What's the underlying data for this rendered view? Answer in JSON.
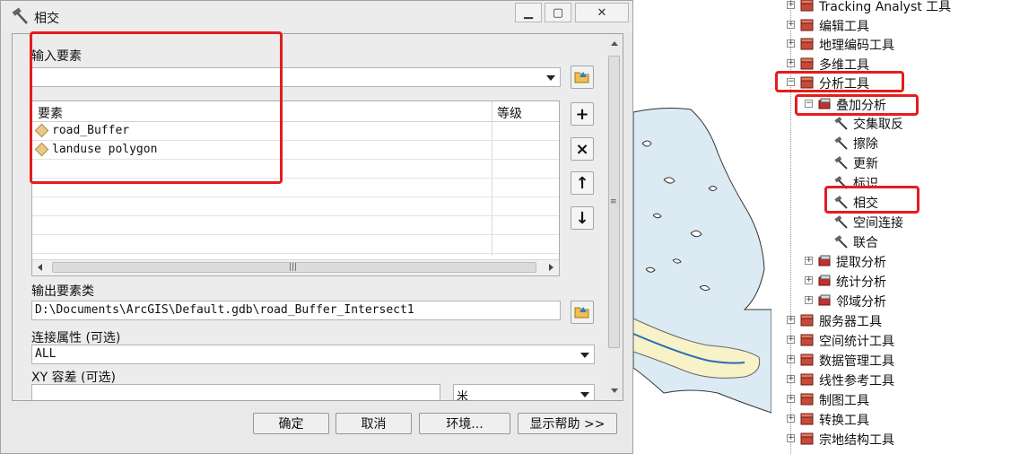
{
  "dialog": {
    "title": "相交",
    "window_buttons": {
      "minimize": "▁",
      "maximize": "▢",
      "close": "✕"
    },
    "input_features_label": "输入要素",
    "grid_headers": {
      "features": "要素",
      "rank": "等级"
    },
    "features": [
      "road_Buffer",
      "landuse polygon"
    ],
    "side_buttons": {
      "add": "+",
      "remove": "×",
      "up": "↑",
      "down": "↓"
    },
    "output_label": "输出要素类",
    "output_value": "D:\\Documents\\ArcGIS\\Default.gdb\\road_Buffer_Intersect1",
    "join_label": "连接属性 (可选)",
    "join_value": "ALL",
    "xy_label": "XY 容差 (可选)",
    "xy_value": "",
    "xy_unit": "米",
    "buttons": {
      "ok": "确定",
      "cancel": "取消",
      "env": "环境...",
      "help": "显示帮助 >>"
    }
  },
  "toolbox": {
    "items": [
      {
        "label": "Tracking Analyst 工具",
        "expander": "+"
      },
      {
        "label": "编辑工具",
        "expander": "+"
      },
      {
        "label": "地理编码工具",
        "expander": "+"
      },
      {
        "label": "多维工具",
        "expander": "+"
      },
      {
        "label": "分析工具",
        "expander": "−"
      },
      {
        "label": "叠加分析",
        "expander": "−"
      },
      {
        "label": "交集取反"
      },
      {
        "label": "擦除"
      },
      {
        "label": "更新"
      },
      {
        "label": "标识"
      },
      {
        "label": "相交"
      },
      {
        "label": "空间连接"
      },
      {
        "label": "联合"
      },
      {
        "label": "提取分析",
        "expander": "+"
      },
      {
        "label": "统计分析",
        "expander": "+"
      },
      {
        "label": "邻域分析",
        "expander": "+"
      },
      {
        "label": "服务器工具",
        "expander": "+"
      },
      {
        "label": "空间统计工具",
        "expander": "+"
      },
      {
        "label": "数据管理工具",
        "expander": "+"
      },
      {
        "label": "线性参考工具",
        "expander": "+"
      },
      {
        "label": "制图工具",
        "expander": "+"
      },
      {
        "label": "转换工具",
        "expander": "+"
      },
      {
        "label": "宗地结构工具",
        "expander": "+"
      }
    ]
  },
  "colors": {
    "highlight": "#e41d1d",
    "map_water": "#dbeaf3",
    "buffer_fill": "#f7f2c7",
    "road": "#2a6db5"
  }
}
